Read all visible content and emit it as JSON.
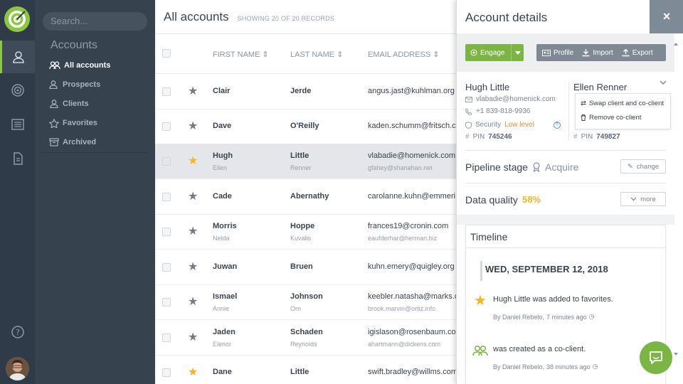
{
  "sidebar": {
    "search_placeholder": "Search...",
    "section_title": "Accounts",
    "items": [
      {
        "label": "All accounts",
        "icon": "users-icon"
      },
      {
        "label": "Prospects",
        "icon": "user-plus-icon"
      },
      {
        "label": "Clients",
        "icon": "user-icon"
      },
      {
        "label": "Favorites",
        "icon": "star-icon"
      },
      {
        "label": "Archived",
        "icon": "archive-icon"
      }
    ]
  },
  "main": {
    "title": "All accounts",
    "record_count": "SHOWING 20 OF 20 RECORDS",
    "columns": {
      "first_name": "FIRST NAME",
      "last_name": "LAST NAME",
      "email": "EMAIL ADDRESS"
    },
    "rows": [
      {
        "first": "Clair",
        "last": "Jerde",
        "email": "angus.jast@kuhlman.org",
        "fav": false
      },
      {
        "first": "Dave",
        "last": "O'Reilly",
        "email": "kaden.schumm@fritsch.co",
        "fav": false
      },
      {
        "first": "Hugh",
        "first2": "Ellen",
        "last": "Little",
        "last2": "Renner",
        "email": "vlabadie@homenick.com",
        "email2": "gfahey@shanahan.net",
        "fav": true,
        "selected": true
      },
      {
        "first": "Cade",
        "last": "Abernathy",
        "email": "carolanne.kuhn@emmeri",
        "fav": false
      },
      {
        "first": "Morris",
        "first2": "Nelda",
        "last": "Hoppe",
        "last2": "Kuvalis",
        "email": "frances19@cronin.com",
        "email2": "eaufderhar@herman.biz",
        "fav": false
      },
      {
        "first": "Juwan",
        "last": "Bruen",
        "email": "kuhn.emery@quigley.org",
        "fav": false
      },
      {
        "first": "Ismael",
        "first2": "Annie",
        "last": "Johnson",
        "last2": "Orn",
        "email": "keebler.natasha@marks.c",
        "email2": "brook.marvin@ortiz.info",
        "fav": false
      },
      {
        "first": "Jaden",
        "first2": "Elenor",
        "last": "Schaden",
        "last2": "Reynolds",
        "email": "igislason@rosenbaum.co",
        "email2": "ahartmann@dickens.com",
        "fav": false
      },
      {
        "first": "Dane",
        "last": "Little",
        "email": "swift.bradley@willms.com",
        "fav": true
      }
    ]
  },
  "panel": {
    "title": "Account details",
    "close": "×",
    "engage": "Engage",
    "profile": "Profile",
    "import": "Import",
    "export": "Export",
    "client": {
      "name": "Hugh Little",
      "email": "vlabadie@homenick.com",
      "phone": "+1 839-818-9936",
      "security_label": "Security",
      "security_value": "Low level",
      "pin_label": "PIN",
      "pin": "745246"
    },
    "coclient": {
      "name": "Ellen Renner",
      "pin_label": "PIN",
      "pin": "749827"
    },
    "menu": {
      "swap": "Swap client and co-client",
      "remove": "Remove co-client"
    },
    "pipeline_label": "Pipeline stage",
    "pipeline_value": "Acquire",
    "change": "change",
    "quality_label": "Data quality",
    "quality_value": "58%",
    "more": "more",
    "timeline": {
      "title": "Timeline",
      "date": "WED, SEPTEMBER 12, 2018",
      "events": [
        {
          "text": "Hugh Little was added to favorites.",
          "by": "By Daniel Rebelo,",
          "time": "7 minutes ago"
        },
        {
          "text": "was created as a co-client.",
          "by": "By Daniel Rebelo,",
          "time": "38 minutes ago"
        }
      ]
    }
  },
  "colors": {
    "accent": "#7bb543",
    "rail": "#2f3b48",
    "sidebar": "#36434f",
    "star_fav": "#f6b61b",
    "warning": "#f0883a",
    "quality": "#f6b61b"
  }
}
